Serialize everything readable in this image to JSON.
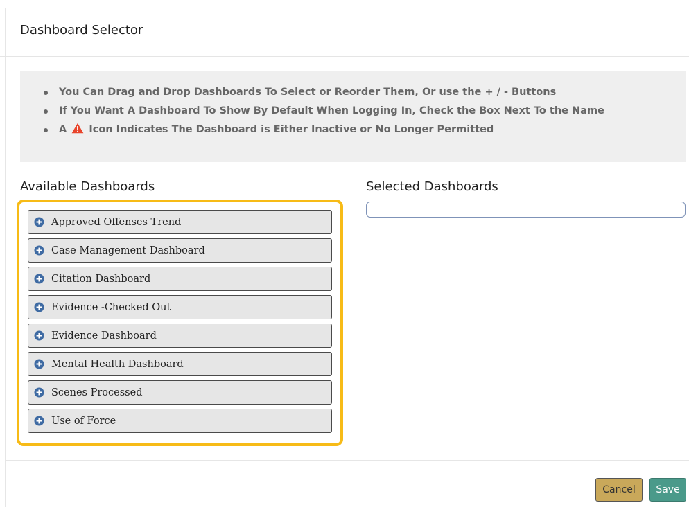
{
  "dialog": {
    "title": "Dashboard Selector"
  },
  "instructions": {
    "line1": "You Can Drag and Drop Dashboards To Select or Reorder Them, Or use the + / - Buttons",
    "line2": "If You Want A Dashboard To Show By Default When Logging In, Check the Box Next To the Name",
    "line3_prefix": "A",
    "line3_icon": "warning-icon",
    "line3_suffix": "Icon Indicates The Dashboard is Either Inactive or No Longer Permitted"
  },
  "available": {
    "title": "Available Dashboards",
    "items": [
      {
        "label": "Approved Offenses Trend",
        "icon": "plus-circle-icon"
      },
      {
        "label": "Case Management Dashboard",
        "icon": "plus-circle-icon"
      },
      {
        "label": "Citation Dashboard",
        "icon": "plus-circle-icon"
      },
      {
        "label": "Evidence -Checked Out",
        "icon": "plus-circle-icon"
      },
      {
        "label": "Evidence Dashboard",
        "icon": "plus-circle-icon"
      },
      {
        "label": "Mental Health Dashboard",
        "icon": "plus-circle-icon"
      },
      {
        "label": "Scenes Processed",
        "icon": "plus-circle-icon"
      },
      {
        "label": "Use of Force",
        "icon": "plus-circle-icon"
      }
    ]
  },
  "selected": {
    "title": "Selected Dashboards",
    "items": []
  },
  "footer": {
    "cancel_label": "Cancel",
    "save_label": "Save"
  },
  "colors": {
    "highlight_border": "#f7bb17",
    "warning": "#e8452c",
    "cancel_bg": "#c9a85a",
    "save_bg": "#4a9a8a",
    "plus_icon": "#3f6ba3"
  }
}
